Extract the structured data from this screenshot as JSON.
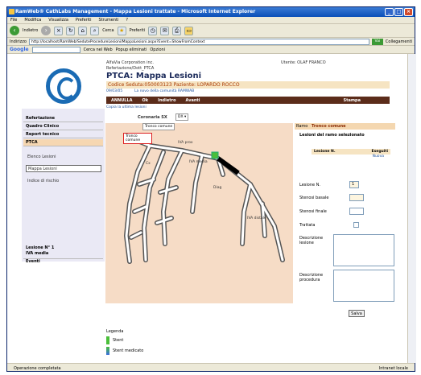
{
  "window": {
    "title": "RamWeb® CathLabs Management - Mappa Lesioni trattate - Microsoft Internet Explorer"
  },
  "menu": [
    "File",
    "Modifica",
    "Visualizza",
    "Preferiti",
    "Strumenti",
    "?"
  ],
  "toolbar": {
    "back": "Indietro",
    "search": "Cerca",
    "favorites": "Preferiti"
  },
  "address": {
    "label": "Indirizzo",
    "url": "http://localhost/RamWeb/SeduteProcedureLesioni/MappaLesioni.aspx?Event=ShowFromContext",
    "go": "Vai",
    "links": "Collegamenti"
  },
  "google": {
    "brand": "Google",
    "search": "Cerca nel Web",
    "popup": "Popup eliminati",
    "options": "Opzioni"
  },
  "header": {
    "org": "AlfaVia Corporation inc.",
    "path": "Refertazione/Dott_PTCA",
    "title": "PTCA: Mappa Lesioni",
    "code": "Codice Seduta:050003123  Paziente: LOPARDO ROCCO",
    "date": "09/03/05",
    "community": "La novo della comunità RAMWAB",
    "user": "Utente: OLAF FRANCO"
  },
  "actions": [
    "ANNULLA",
    "Ok",
    "Indietro",
    "Avanti",
    "Stampa"
  ],
  "sidebar": {
    "items": [
      "Refertazione",
      "Quadro Clinico",
      "Report tecnico",
      "PTCA"
    ],
    "subitems": [
      "Elenco Lesioni",
      "Mappa Lesioni",
      "Indice di rischio"
    ],
    "footer1": "Lesione N° 1",
    "footer2": "IVA media",
    "footer3": "Eventi"
  },
  "diagram": {
    "last_link": "Copia la ultima lesioni",
    "coronaria": "Coronaria SX",
    "dropdown": "DX",
    "label_tronco": "Tronco comune",
    "label_tronco2": "Tronco comune",
    "label_prox": "IVA prox",
    "label_media": "IVA media",
    "label_dist": "IVA distale",
    "label_diag": "Diag",
    "label_cx": "Cx"
  },
  "legend": {
    "title": "Legenda",
    "stent": "Stent",
    "stent_med": "Stent medicato"
  },
  "panel": {
    "header_label": "Ramo",
    "header_value": "Tronco comune",
    "subtitle": "Lesioni del ramo selezionato",
    "col1": "Lesione N.",
    "col2": "Eseguiti",
    "col2_val": "Nuova",
    "lesione": "Lesione N.",
    "lesione_val": "1",
    "stenosi_basale": "Stenosi basale",
    "stenosi_finale": "Stenosi finale",
    "trattata": "Trattata",
    "desc_lesione": "Descrizione lesione",
    "desc_proc": "Descrizione procedura",
    "save": "Salva"
  },
  "status": {
    "left": "Operazione completata",
    "right": "Intranet locale"
  }
}
